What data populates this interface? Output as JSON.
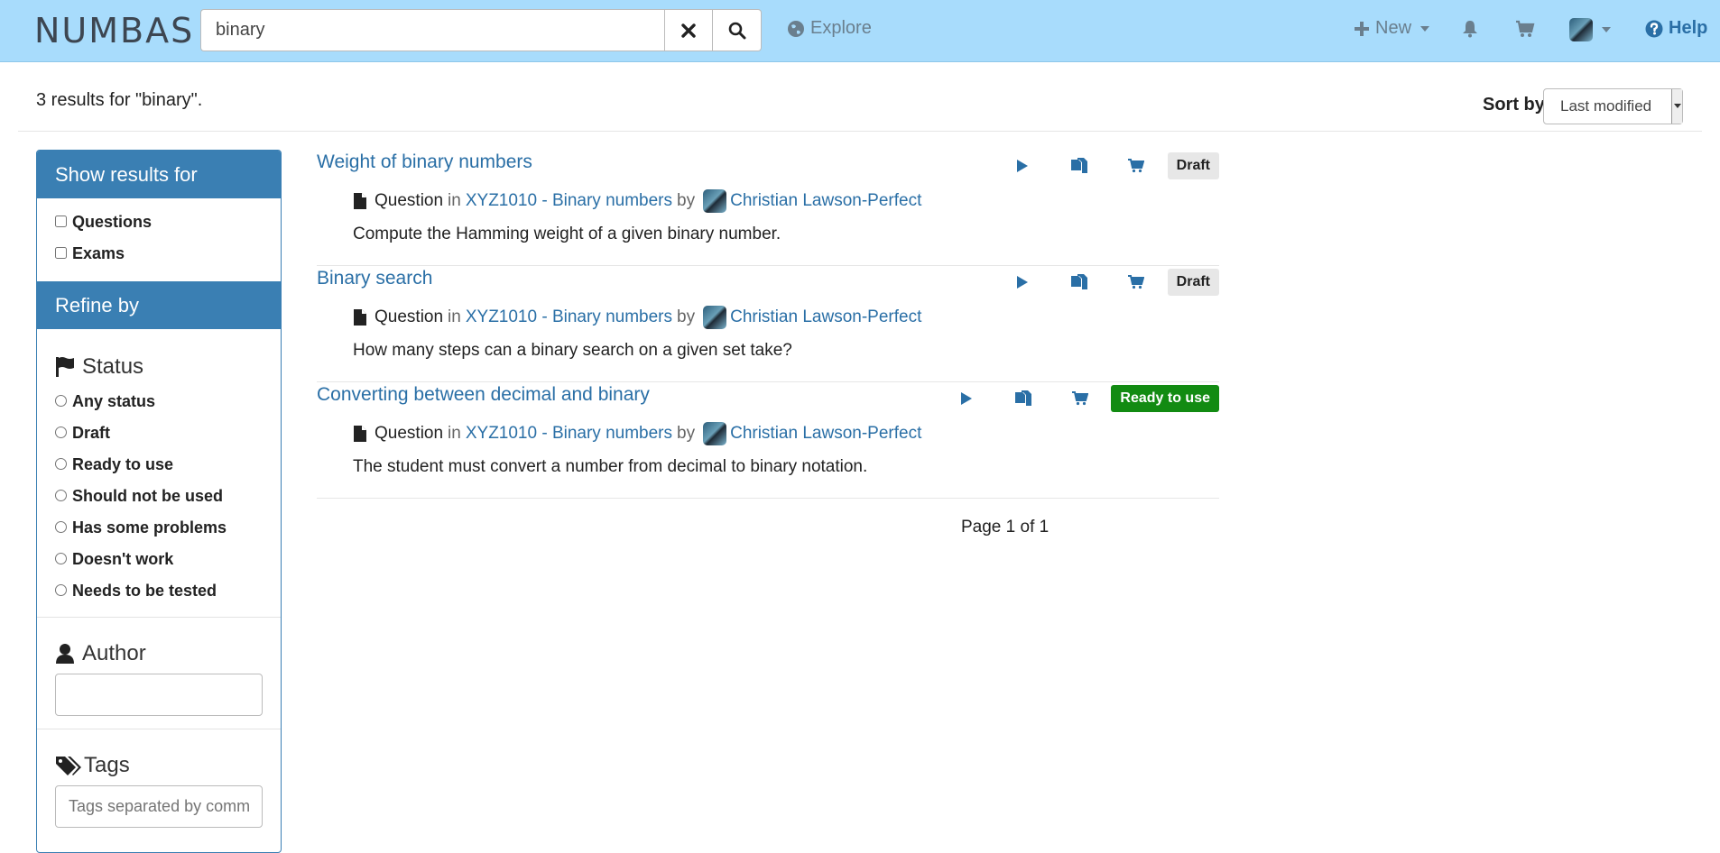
{
  "topbar": {
    "brand": "NUMBAS",
    "search_value": "binary",
    "explore_label": "Explore",
    "new_label": "New",
    "help_label": "Help"
  },
  "results": {
    "count_text": "3 results for \"binary\".",
    "sort_label": "Sort by",
    "sort_value": "Last modified",
    "page_text": "Page 1 of 1",
    "items": [
      {
        "title": "Weight of binary numbers",
        "type": "Question",
        "in_word": "in",
        "project": "XYZ1010 - Binary numbers",
        "by_word": "by",
        "author": "Christian Lawson-Perfect",
        "description": "Compute the Hamming weight of a given binary number.",
        "status": "Draft"
      },
      {
        "title": "Binary search",
        "type": "Question",
        "in_word": "in",
        "project": "XYZ1010 - Binary numbers",
        "by_word": "by",
        "author": "Christian Lawson-Perfect",
        "description": "How many steps can a binary search on a given set take?",
        "status": "Draft"
      },
      {
        "title": "Converting between decimal and binary",
        "type": "Question",
        "in_word": "in",
        "project": "XYZ1010 - Binary numbers",
        "by_word": "by",
        "author": "Christian Lawson-Perfect",
        "description": "The student must convert a number from decimal to binary notation.",
        "status": "Ready to use"
      }
    ]
  },
  "sidebar": {
    "show_results_heading": "Show results for",
    "show_options": [
      "Questions",
      "Exams"
    ],
    "refine_heading": "Refine by",
    "status_heading": "Status",
    "status_options": [
      "Any status",
      "Draft",
      "Ready to use",
      "Should not be used",
      "Has some problems",
      "Doesn't work",
      "Needs to be tested"
    ],
    "author_heading": "Author",
    "author_value": "",
    "tags_heading": "Tags",
    "tags_placeholder": "Tags separated by commas"
  },
  "colors": {
    "topbar": "#a8dcfc",
    "accent": "#3a7fb3",
    "link": "#2a6fa6",
    "ready_badge": "#128b12",
    "draft_badge": "#e7e7e7"
  },
  "icons": {
    "clear": "times-icon",
    "search": "magnifier-icon",
    "explore": "globe-icon",
    "new": "plus-icon",
    "notifications": "bell-icon",
    "basket": "cart-icon",
    "help": "question-circle-icon",
    "status": "flag-icon",
    "author": "user-icon",
    "tags": "tags-icon",
    "item_type": "file-icon",
    "run": "play-icon",
    "copy": "copy-icon",
    "add_to_basket": "cart-icon"
  }
}
